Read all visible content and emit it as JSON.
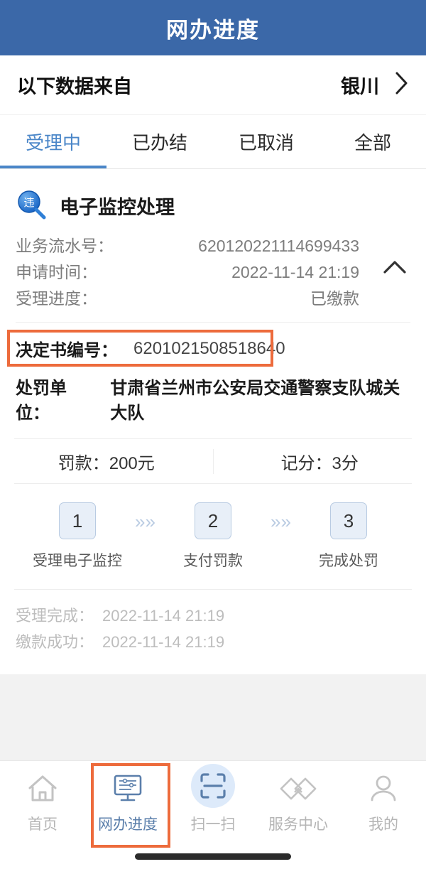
{
  "header": {
    "title": "网办进度"
  },
  "source": {
    "label": "以下数据来自",
    "city": "银川",
    "chevron_icon": "chevron-right-icon"
  },
  "tabs": [
    {
      "label": "受理中",
      "active": true
    },
    {
      "label": "已办结",
      "active": false
    },
    {
      "label": "已取消",
      "active": false
    },
    {
      "label": "全部",
      "active": false
    }
  ],
  "card": {
    "badge_text": "违",
    "badge_icon": "violation-search-icon",
    "title": "电子监控处理",
    "collapse_icon": "chevron-up-icon",
    "info": [
      {
        "key": "业务流水号：",
        "value": "620120221114699433"
      },
      {
        "key": "申请时间：",
        "value": "2022-11-14 21:19"
      },
      {
        "key": "受理进度：",
        "value": "已缴款"
      }
    ],
    "decision": {
      "key": "决定书编号：",
      "value": "6201021508518640"
    },
    "unit": {
      "key": "处罚单位：",
      "value": "甘肃省兰州市公安局交通警察支队城关大队"
    },
    "fine": {
      "label": "罚款：200元"
    },
    "points": {
      "label": "记分：3分"
    },
    "steps": [
      {
        "num": "1",
        "label": "受理电子监控"
      },
      {
        "num": "2",
        "label": "支付罚款"
      },
      {
        "num": "3",
        "label": "完成处罚"
      }
    ],
    "step_arrow": "»»",
    "logs": [
      {
        "key": "受理完成：",
        "value": "2022-11-14 21:19"
      },
      {
        "key": "缴款成功：",
        "value": "2022-11-14 21:19"
      }
    ]
  },
  "bottom_nav": [
    {
      "label": "首页",
      "icon": "home-icon",
      "active": false
    },
    {
      "label": "网办进度",
      "icon": "monitor-icon",
      "active": true
    },
    {
      "label": "扫一扫",
      "icon": "scan-icon",
      "active": false
    },
    {
      "label": "服务中心",
      "icon": "handshake-icon",
      "active": false
    },
    {
      "label": "我的",
      "icon": "user-icon",
      "active": false
    }
  ],
  "colors": {
    "header_blue": "#3b68a8",
    "tab_active": "#4a86c8",
    "highlight_orange": "#ed6b3c",
    "page_bg": "#f2f2f2",
    "step_box_bg": "#e8eff8",
    "scan_circle": "#ddeafa"
  }
}
